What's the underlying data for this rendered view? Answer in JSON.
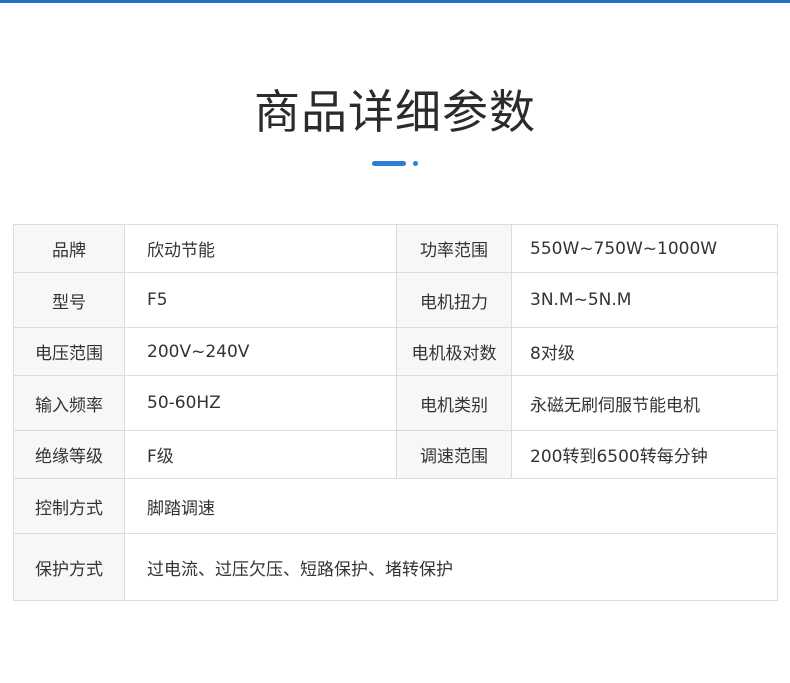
{
  "page": {
    "title": "商品详细参数",
    "accent_color": "#2f7bd6",
    "top_bar_color": "#2a6fbf"
  },
  "specs": {
    "rows": [
      {
        "label1": "品牌",
        "value1": "欣动节能",
        "label2": "功率范围",
        "value2": "550W~750W~1000W"
      },
      {
        "label1": "型号",
        "value1": "F5",
        "label2": "电机扭力",
        "value2": "3N.M~5N.M"
      },
      {
        "label1": "电压范围",
        "value1": "200V~240V",
        "label2": "电机极对数",
        "value2": "8对级"
      },
      {
        "label1": "输入频率",
        "value1": "50-60HZ",
        "label2": "电机类别",
        "value2": "永磁无刷伺服节能电机"
      },
      {
        "label1": "绝缘等级",
        "value1": "F级",
        "label2": "调速范围",
        "value2": "200转到6500转每分钟"
      }
    ],
    "wide_rows": [
      {
        "label": "控制方式",
        "value": "脚踏调速"
      },
      {
        "label": "保护方式",
        "value": "过电流、过压欠压、短路保护、堵转保护"
      }
    ]
  }
}
